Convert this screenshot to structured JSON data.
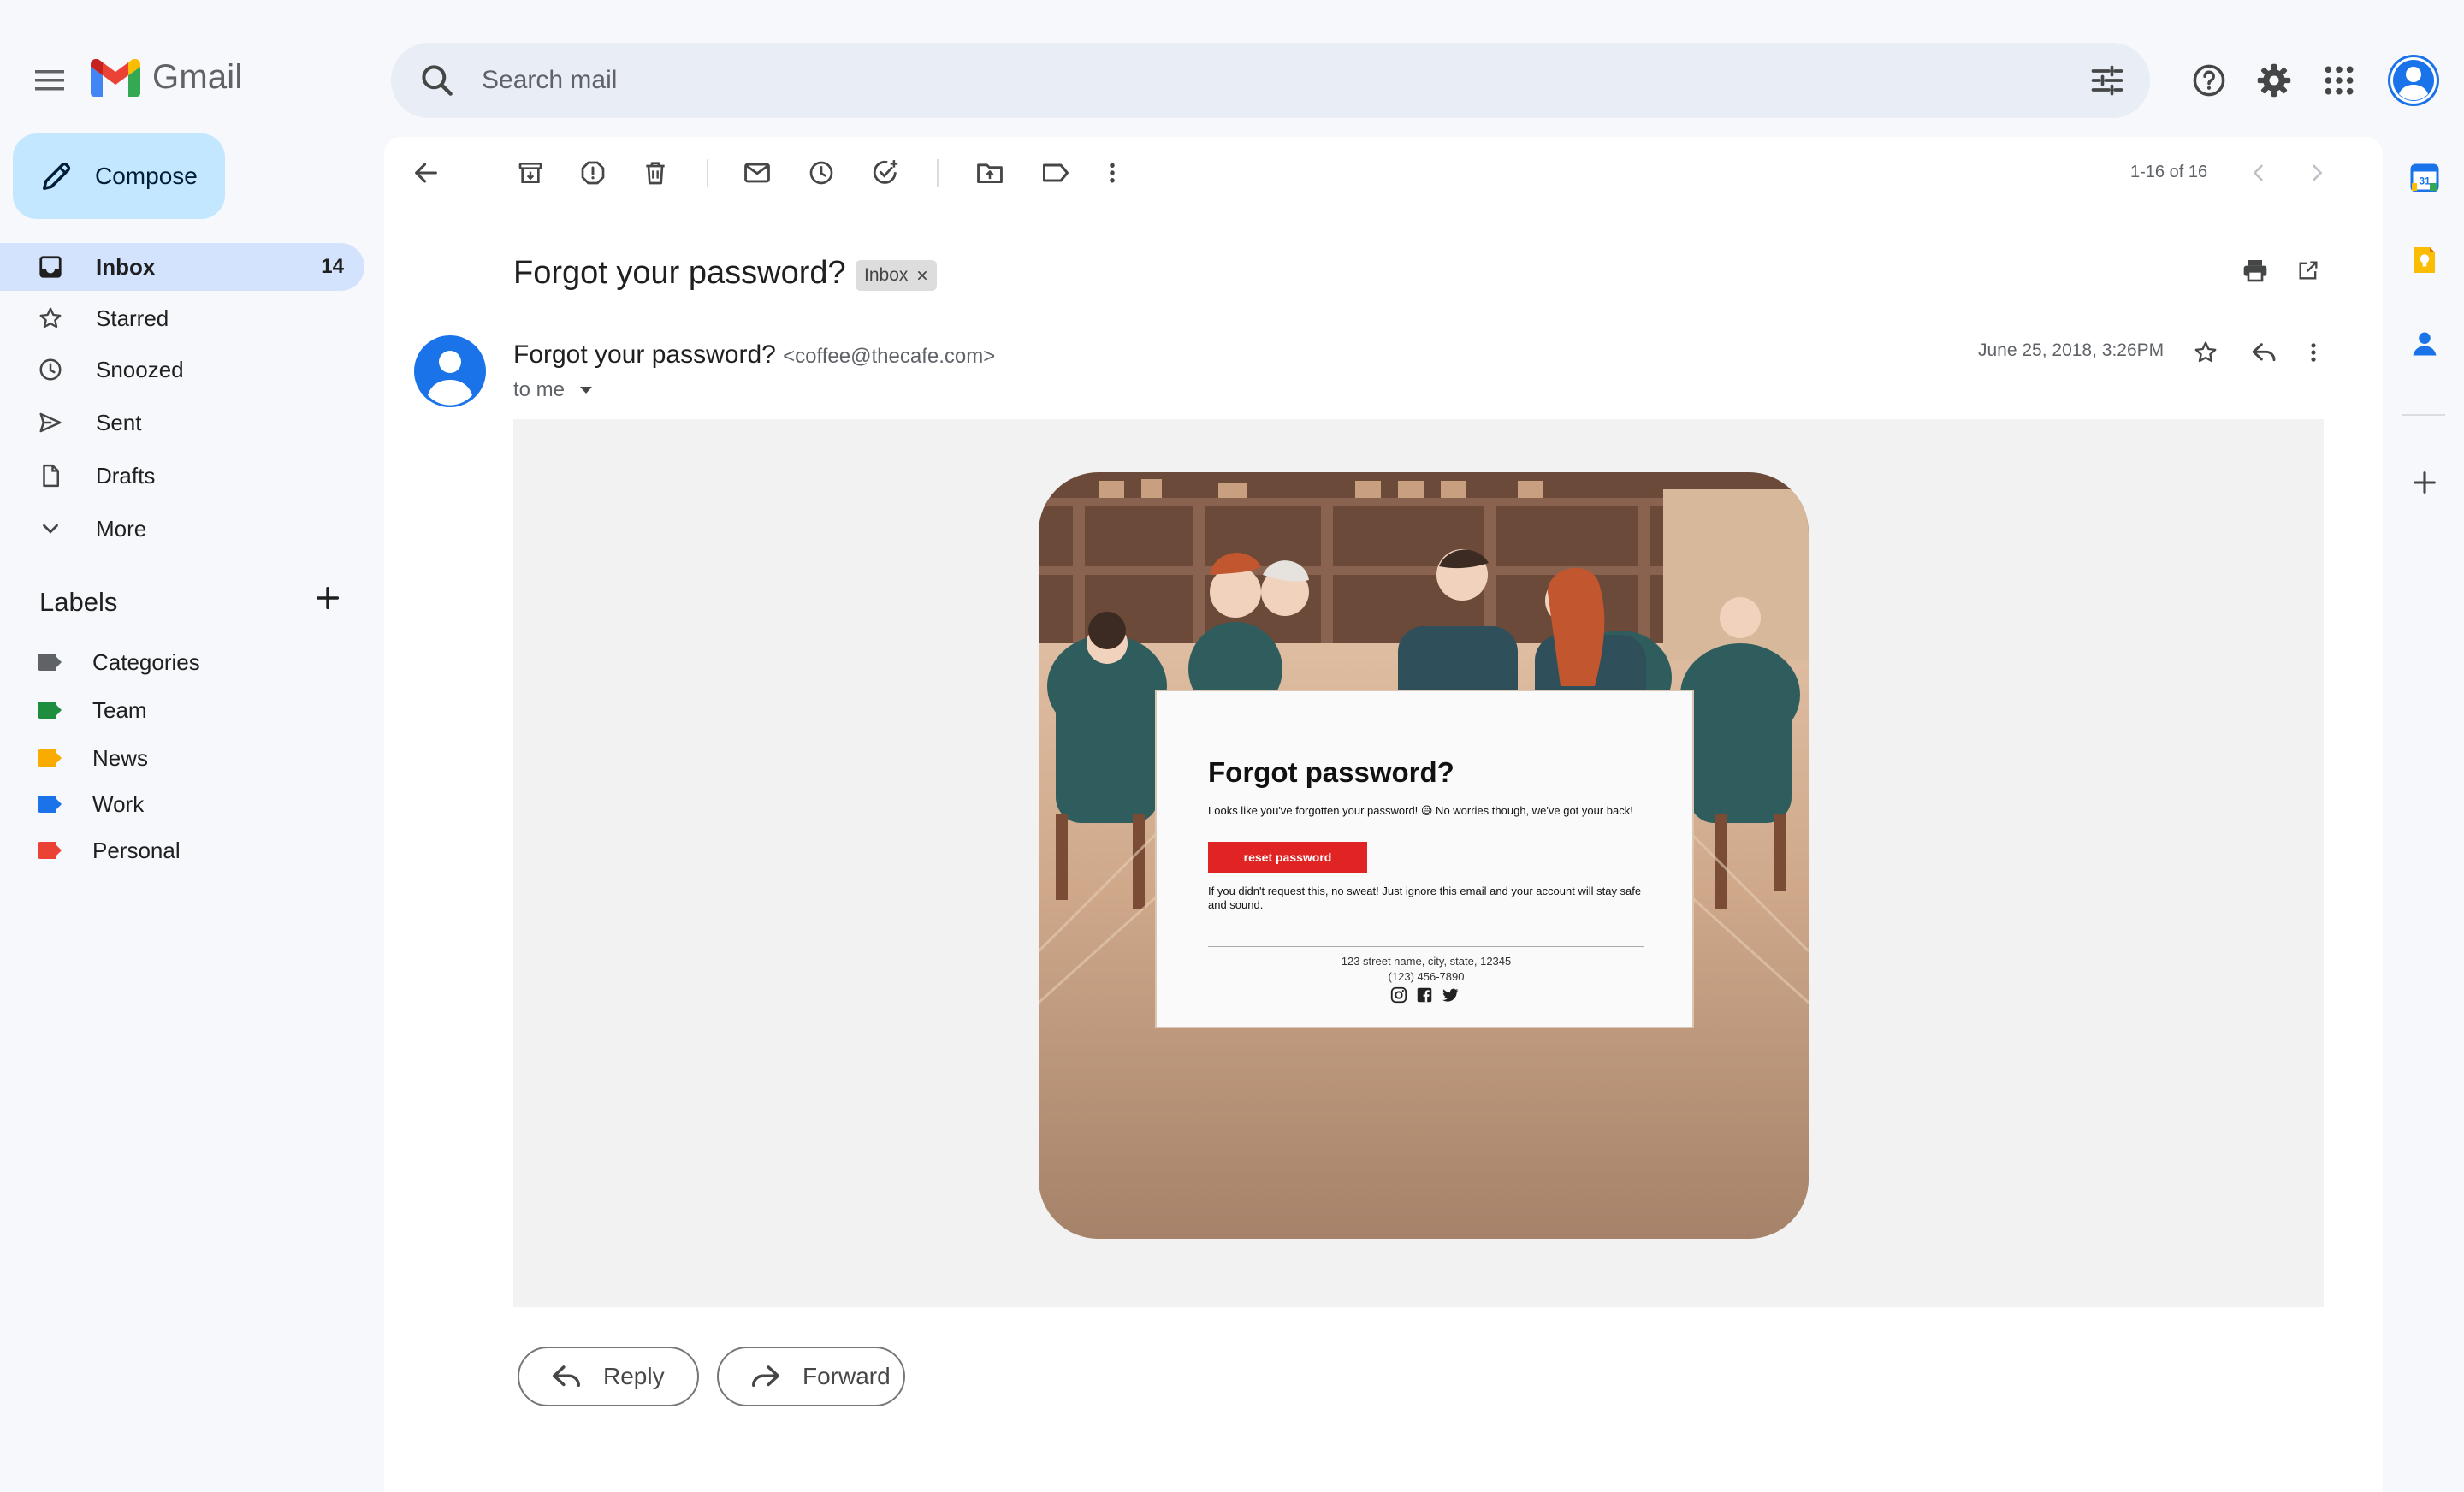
{
  "app": {
    "name": "Gmail"
  },
  "search": {
    "placeholder": "Search mail"
  },
  "sidebar": {
    "compose_label": "Compose",
    "items": [
      {
        "label": "Inbox",
        "count": "14",
        "icon": "inbox-icon"
      },
      {
        "label": "Starred",
        "icon": "star-icon"
      },
      {
        "label": "Snoozed",
        "icon": "clock-icon"
      },
      {
        "label": "Sent",
        "icon": "send-icon"
      },
      {
        "label": "Drafts",
        "icon": "draft-icon"
      },
      {
        "label": "More",
        "icon": "chevron-down-icon"
      }
    ],
    "labels_title": "Labels",
    "labels": [
      {
        "name": "Categories",
        "color": "#5f6368"
      },
      {
        "name": "Team",
        "color": "#1e8e3e"
      },
      {
        "name": "News",
        "color": "#f9ab00"
      },
      {
        "name": "Work",
        "color": "#1a73e8"
      },
      {
        "name": "Personal",
        "color": "#ea4335"
      }
    ]
  },
  "toolbar": {
    "pager": "1-16 of 16"
  },
  "message": {
    "subject": "Forgot your password?",
    "label_chip": "Inbox",
    "sender_name": "Forgot your password?",
    "sender_email": "<coffee@thecafe.com>",
    "to": "to me",
    "date": "June 25, 2018, 3:26PM"
  },
  "email_content": {
    "title": "Forgot password?",
    "text1": "Looks like you've forgotten your password! 😅 No worries though, we've got your back!",
    "button": "reset password",
    "text2": "If you didn't request this, no sweat! Just ignore this email and your account will stay safe and sound.",
    "address": "123 street name, city, state, 12345",
    "phone": "(123) 456-7890"
  },
  "actions": {
    "reply": "Reply",
    "forward": "Forward"
  },
  "colors": {
    "accent": "#1a73e8",
    "compose_bg": "#c2e7ff",
    "active_nav": "#d3e3fd",
    "cta": "#e02424"
  }
}
